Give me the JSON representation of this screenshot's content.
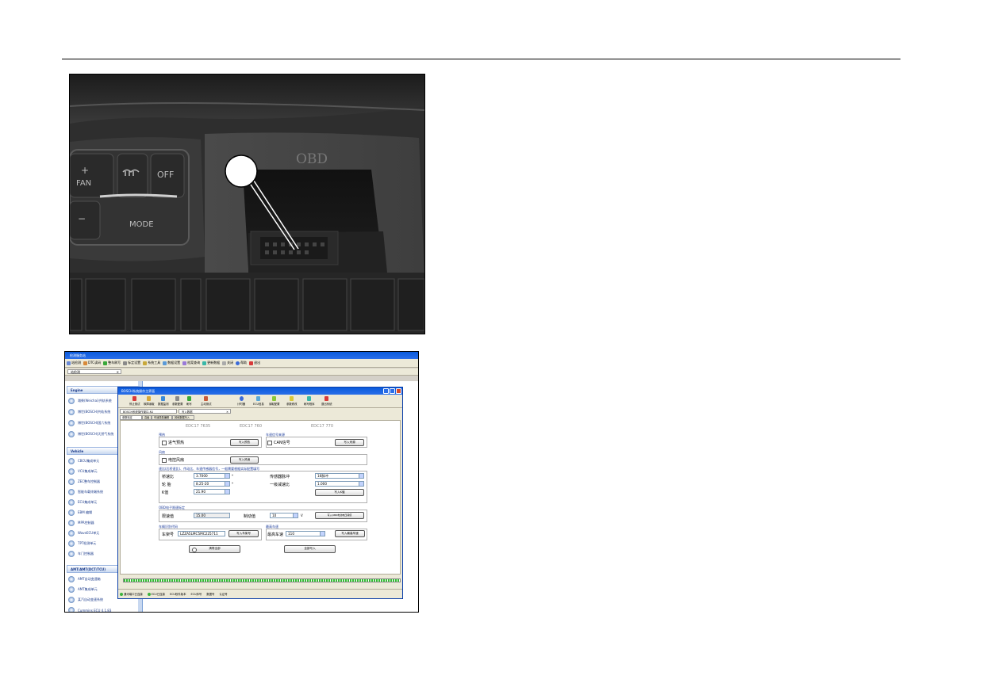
{
  "photo": {
    "obd_label": "OBD",
    "fan_label": "FAN",
    "plus": "+",
    "minus": "−",
    "off_label": "OFF",
    "mode_label": "MODE"
  },
  "app": {
    "title": "检测服务站",
    "menu": [
      "站检测",
      "DTC读码",
      "整车刷写",
      "标定设置",
      "系统工具",
      "数据设置",
      "档案查询",
      "更新数据",
      "关闭",
      "帮助",
      "退出"
    ],
    "outer_tab": "站检测",
    "sidebar": {
      "group_engine": "Engine",
      "engine_items": [
        "潍柴(Weichai)共轨系统",
        "博世(BOSCH)共轨系统",
        "博世(BOSCH)国六系统",
        "博世(BOSCH)天然气系统"
      ],
      "group_vehicle": "Vehicle",
      "vehicle_items": [
        "CBCU集成单元",
        "VCU集成单元",
        "ZEC整车控制器",
        "智能车载终端系统",
        "ECU集成单元",
        "EBM 编辑",
        "MPR控制器",
        "WaveECU单元",
        "TPT检测单元",
        "车门控制器"
      ],
      "group_amt": "AMT/AMT(DCT/TCU)",
      "amt_items": [
        "AMT自动变速箱",
        "AMT集成单元",
        "某汽自动变速系统",
        "Cummins ECU 4.1.83"
      ]
    }
  },
  "window": {
    "title": "BOSCH系统操作主界面",
    "tools": [
      "停止测试",
      "故障读取",
      "数据监测",
      "参数配置",
      "刷写",
      "主动测试",
      "计时器",
      "ECU信息",
      "读取配置",
      "参数修改",
      "刷写程序",
      "退出系统"
    ],
    "doc_tabs": [
      "BOSCH系统操作窗口-N1",
      "写入数据"
    ],
    "sub_tabs": [
      "参数标定",
      "高级",
      "车速类型编辑",
      "其他数据写入"
    ],
    "models": [
      "EDC17 7635",
      "EDC17 760",
      "EDC17 770"
    ],
    "section_preheat": "预热",
    "chk_intake_preheat": "进气预热",
    "btn_write_preheat": "写入预热",
    "section_signal": "车速信号来源",
    "chk_can": "CAN信号",
    "btn_write_signal": "写入来源",
    "section_fan": "风扇",
    "chk_elec_fan": "电控风扇",
    "btn_write_fan": "写入风扇",
    "section_ratio": "速比(后桥速比)、传动比、车速传感器信号，一般需要根据实际配置填写",
    "label_axle_ratio": "桥速比",
    "val_axle_ratio": "3.7000",
    "label_tire": "轮  胎",
    "val_tire": "8.25-20",
    "label_k": "K值",
    "val_k": "21.90",
    "label_sensor_pulse": "传感器脉冲",
    "val_sensor_pulse": "16脉冲",
    "label_first_ratio": "一级减速比",
    "val_first_ratio": "1.000",
    "btn_write_k": "写入K值",
    "section_limit": "OBD电子限速标定",
    "label_limit_val": "限速值",
    "val_limit": "15.00",
    "label_brake_val": "制动值",
    "val_brake": "10",
    "unit_v": "V",
    "btn_write_limit": "写入OBD电池电压阈值",
    "section_vin": "车辆识别代码",
    "label_vin": "车架号",
    "val_vin": "LZZA5LMC5MC225711",
    "btn_write_vin": "写入车架号",
    "section_speed": "最高车速",
    "label_max_speed": "最高车速",
    "val_max_speed": "110",
    "btn_write_speed": "写入最高车速",
    "btn_clear": "清零全部",
    "btn_write_all": "全部写入",
    "status": [
      "通讯端口已连接",
      "ECU已连接",
      "ECU软件版本",
      "ECU序号",
      "数据号",
      "认证号"
    ]
  },
  "colors": {
    "titlebar": "#0a5adc",
    "progress": "#2fc02f",
    "sidebar_text": "#1a3a8a"
  }
}
